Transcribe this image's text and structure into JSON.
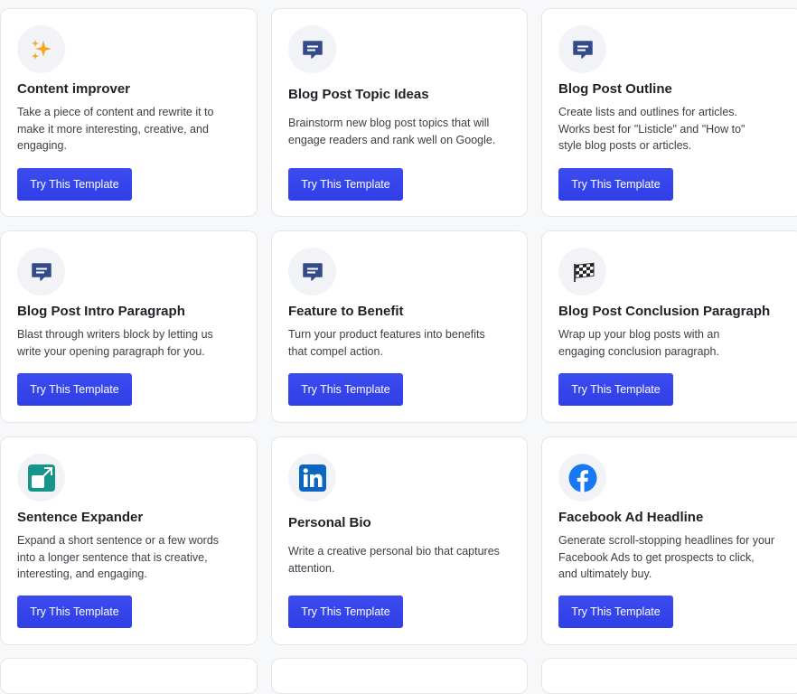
{
  "button_label": "Try This Template",
  "colors": {
    "button": "#3543ec",
    "chat_icon": "#354a8a",
    "sparkle": "#f5a623",
    "expander": "#16958a",
    "linkedin": "#0a66c2",
    "facebook": "#1877f2"
  },
  "cards": [
    {
      "title": "Content improver",
      "description": "Take a piece of content and rewrite it to make it more interesting, creative, and engaging.",
      "icon": "sparkles-icon"
    },
    {
      "title": "Blog Post Topic Ideas",
      "description": "Brainstorm new blog post topics that will engage readers and rank well on Google.",
      "icon": "chat-bubble-icon"
    },
    {
      "title": "Blog Post Outline",
      "description": "Create lists and outlines for articles. Works best for \"Listicle\" and \"How to\" style blog posts or articles.",
      "icon": "chat-bubble-icon"
    },
    {
      "title": "Blog Post Intro Paragraph",
      "description": "Blast through writers block by letting us write your opening paragraph for you.",
      "icon": "chat-bubble-icon"
    },
    {
      "title": "Feature to Benefit",
      "description": "Turn your product features into benefits that compel action.",
      "icon": "chat-bubble-icon"
    },
    {
      "title": "Blog Post Conclusion Paragraph",
      "description": "Wrap up your blog posts with an engaging conclusion paragraph.",
      "icon": "checkered-flag-icon"
    },
    {
      "title": "Sentence Expander",
      "description": "Expand a short sentence or a few words into a longer sentence that is creative, interesting, and engaging.",
      "icon": "expand-arrow-icon"
    },
    {
      "title": "Personal Bio",
      "description": "Write a creative personal bio that captures attention.",
      "icon": "linkedin-icon"
    },
    {
      "title": "Facebook Ad Headline",
      "description": "Generate scroll-stopping headlines for your Facebook Ads to get prospects to click, and ultimately buy.",
      "icon": "facebook-icon"
    }
  ]
}
